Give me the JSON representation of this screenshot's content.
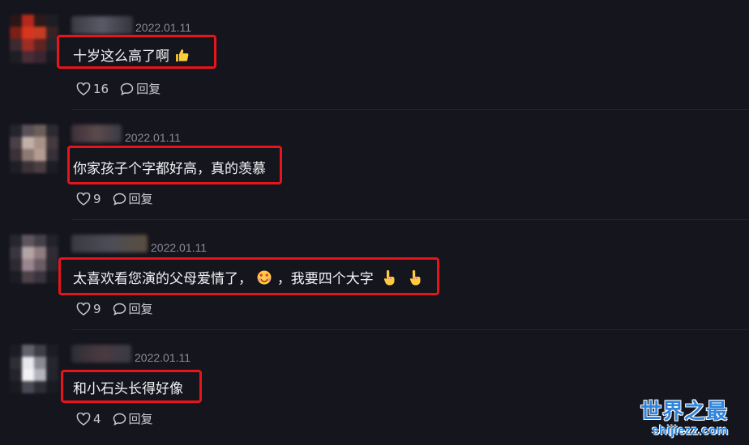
{
  "comments": [
    {
      "date": "2022.01.11",
      "text": "十岁这么高了啊",
      "emoji": "thumbs-up",
      "likes": "16",
      "reply_label": "回复"
    },
    {
      "date": "2022.01.11",
      "text": "你家孩子个字都好高，真的羡慕",
      "likes": "9",
      "reply_label": "回复"
    },
    {
      "date": "2022.01.11",
      "text_before": "太喜欢看您演的父母爱情了，",
      "text_after": "，我要四个大字",
      "emojis": [
        "heart-face",
        "hand-up",
        "hand-up"
      ],
      "likes": "9",
      "reply_label": "回复"
    },
    {
      "date": "2022.01.11",
      "text": "和小石头长得好像",
      "likes": "4",
      "reply_label": "回复"
    }
  ],
  "watermark": {
    "title": "世界之最",
    "url": "shijiezz.com"
  },
  "colors": {
    "background": "#15151d",
    "highlight": "#e8141c",
    "watermark": "#2f84dc"
  }
}
